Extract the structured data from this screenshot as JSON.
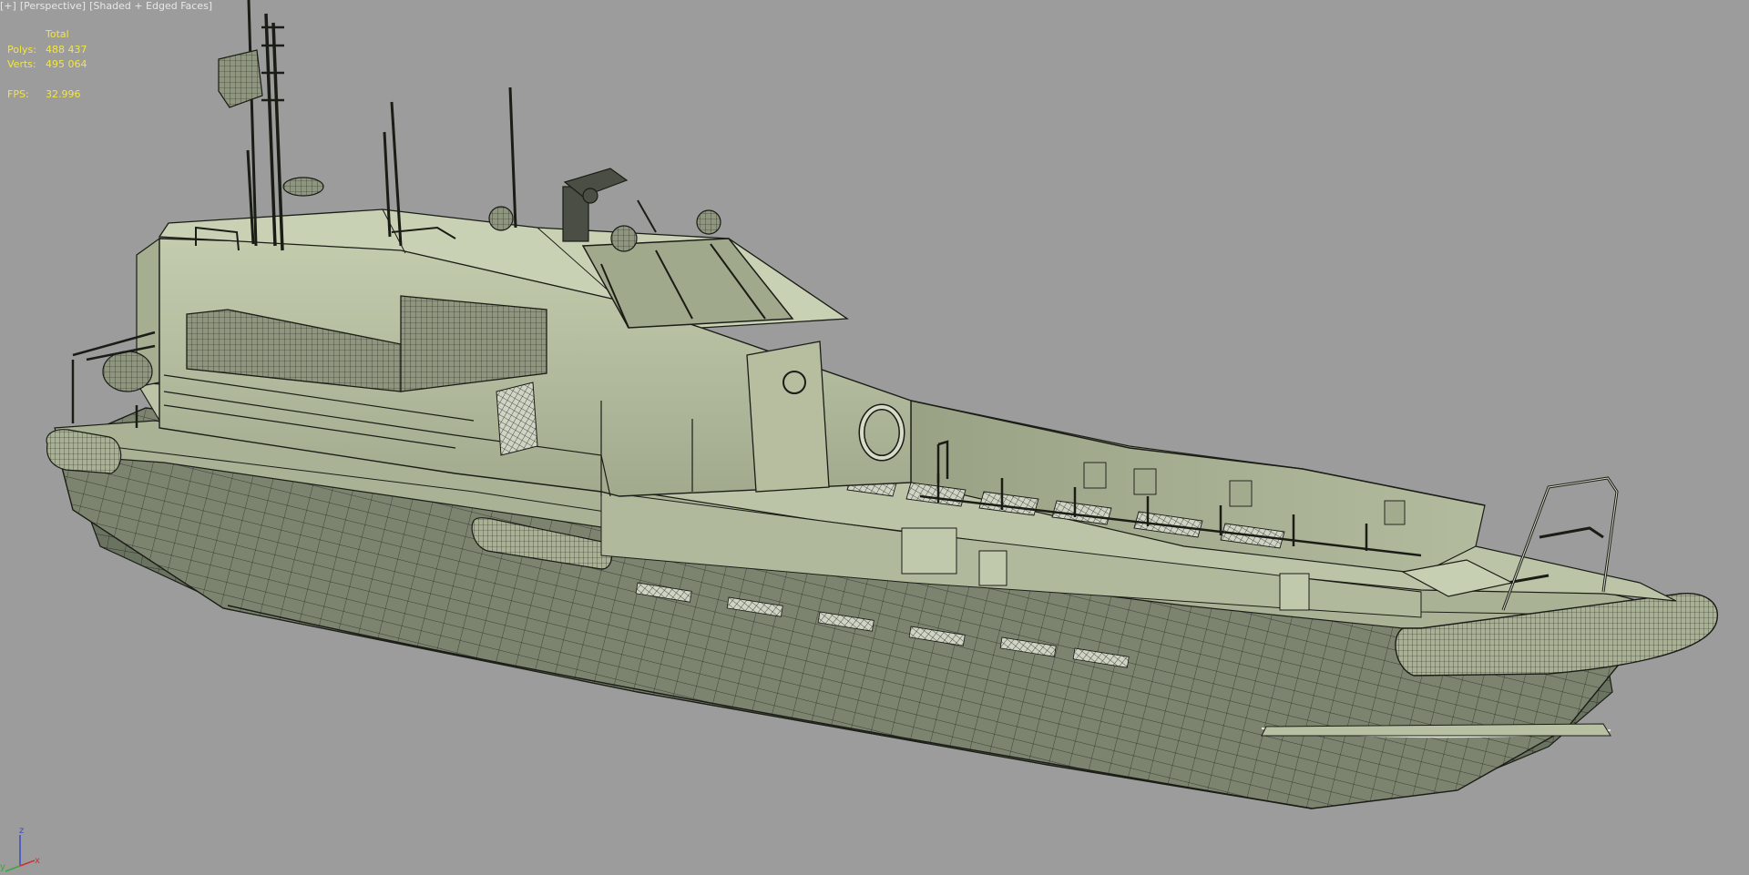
{
  "viewport": {
    "labels": [
      "[+]",
      "[Perspective]",
      "[Shaded + Edged Faces]"
    ]
  },
  "stats": {
    "header": "Total",
    "polys_label": "Polys:",
    "polys_value": "488 437",
    "verts_label": "Verts:",
    "verts_value": "495 064",
    "fps_label": "FPS:",
    "fps_value": "32.996"
  },
  "axis": {
    "x": "x",
    "y": "y",
    "z": "z"
  },
  "colors": {
    "background": "#9c9c9c",
    "stats_text": "#f2e640",
    "hull": "#7c8470",
    "superstructure": "#b6bea2",
    "wire": "#1a1c16"
  }
}
